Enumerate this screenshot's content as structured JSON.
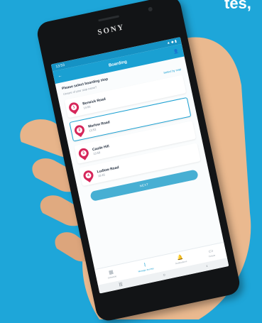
{
  "background": {
    "corner_text": "tes,",
    "color": "#1ea6d9"
  },
  "device": {
    "brand": "SONY"
  },
  "status_bar": {
    "time": "13:53",
    "icons": "▲ ◆ ▮"
  },
  "app_bar": {
    "title": "Boarding",
    "back": "←"
  },
  "content": {
    "prompt": "Please select boarding stop",
    "subprompt": "Unsure of your stop name?",
    "select_on_map": "Select by map",
    "stops": [
      {
        "num": "1",
        "name": "Berwick Road",
        "time": "14:06"
      },
      {
        "num": "2",
        "name": "Marlow Road",
        "time": "13:53"
      },
      {
        "num": "3",
        "name": "Castle Hill",
        "time": "13:58"
      },
      {
        "num": "4",
        "name": "Ludlow Road",
        "time": "15:45"
      }
    ],
    "next_button": "NEXT"
  },
  "bottom_nav": [
    {
      "label": "Schedule",
      "icon": "calendar-icon",
      "glyph": "▦"
    },
    {
      "label": "Manage Journey",
      "icon": "route-icon",
      "glyph": "⌇"
    },
    {
      "label": "Notifications",
      "icon": "bell-icon",
      "glyph": "🔔"
    },
    {
      "label": "Tickets",
      "icon": "ticket-icon",
      "glyph": "▭"
    }
  ],
  "colors": {
    "brand": "#1aa0d2",
    "pin": "#d6265a"
  }
}
